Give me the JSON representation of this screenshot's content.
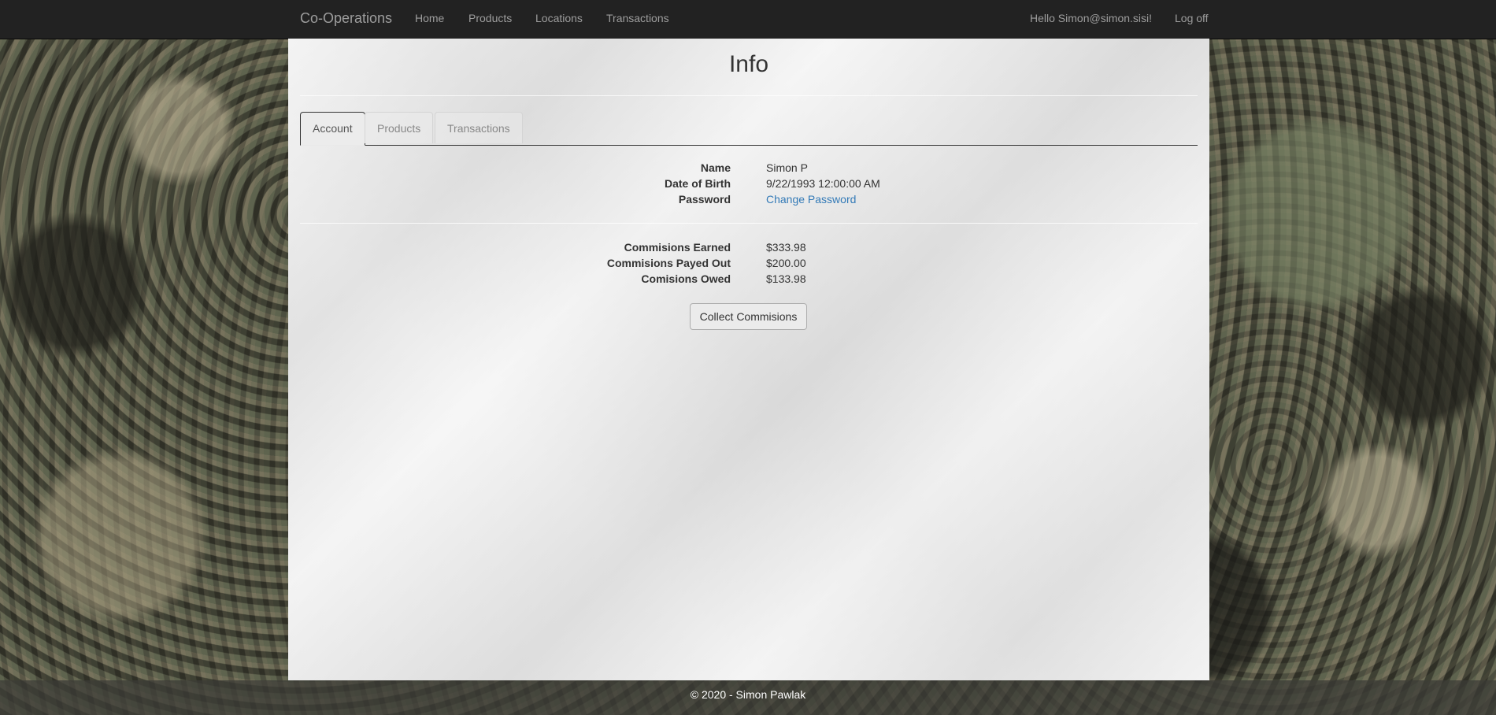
{
  "navbar": {
    "brand": "Co-Operations",
    "links": [
      "Home",
      "Products",
      "Locations",
      "Transactions"
    ],
    "greeting": "Hello Simon@simon.sisi!",
    "logoff": "Log off"
  },
  "main": {
    "title": "Info",
    "tabs": [
      {
        "label": "Account",
        "active": true
      },
      {
        "label": "Products",
        "active": false
      },
      {
        "label": "Transactions",
        "active": false
      }
    ],
    "account": {
      "name_label": "Name",
      "name_value": "Simon P",
      "dob_label": "Date of Birth",
      "dob_value": "9/22/1993 12:00:00 AM",
      "password_label": "Password",
      "password_link": "Change Password"
    },
    "commissions": {
      "earned_label": "Commisions Earned",
      "earned_value": "$333.98",
      "payed_label": "Commisions Payed Out",
      "payed_value": "$200.00",
      "owed_label": "Comisions Owed",
      "owed_value": "$133.98"
    },
    "collect_button": "Collect Commisions"
  },
  "footer": {
    "text": "© 2020 - Simon Pawlak"
  },
  "colors": {
    "navbar_bg": "#222222",
    "nav_text": "#9d9d9d",
    "link": "#337ab7"
  }
}
